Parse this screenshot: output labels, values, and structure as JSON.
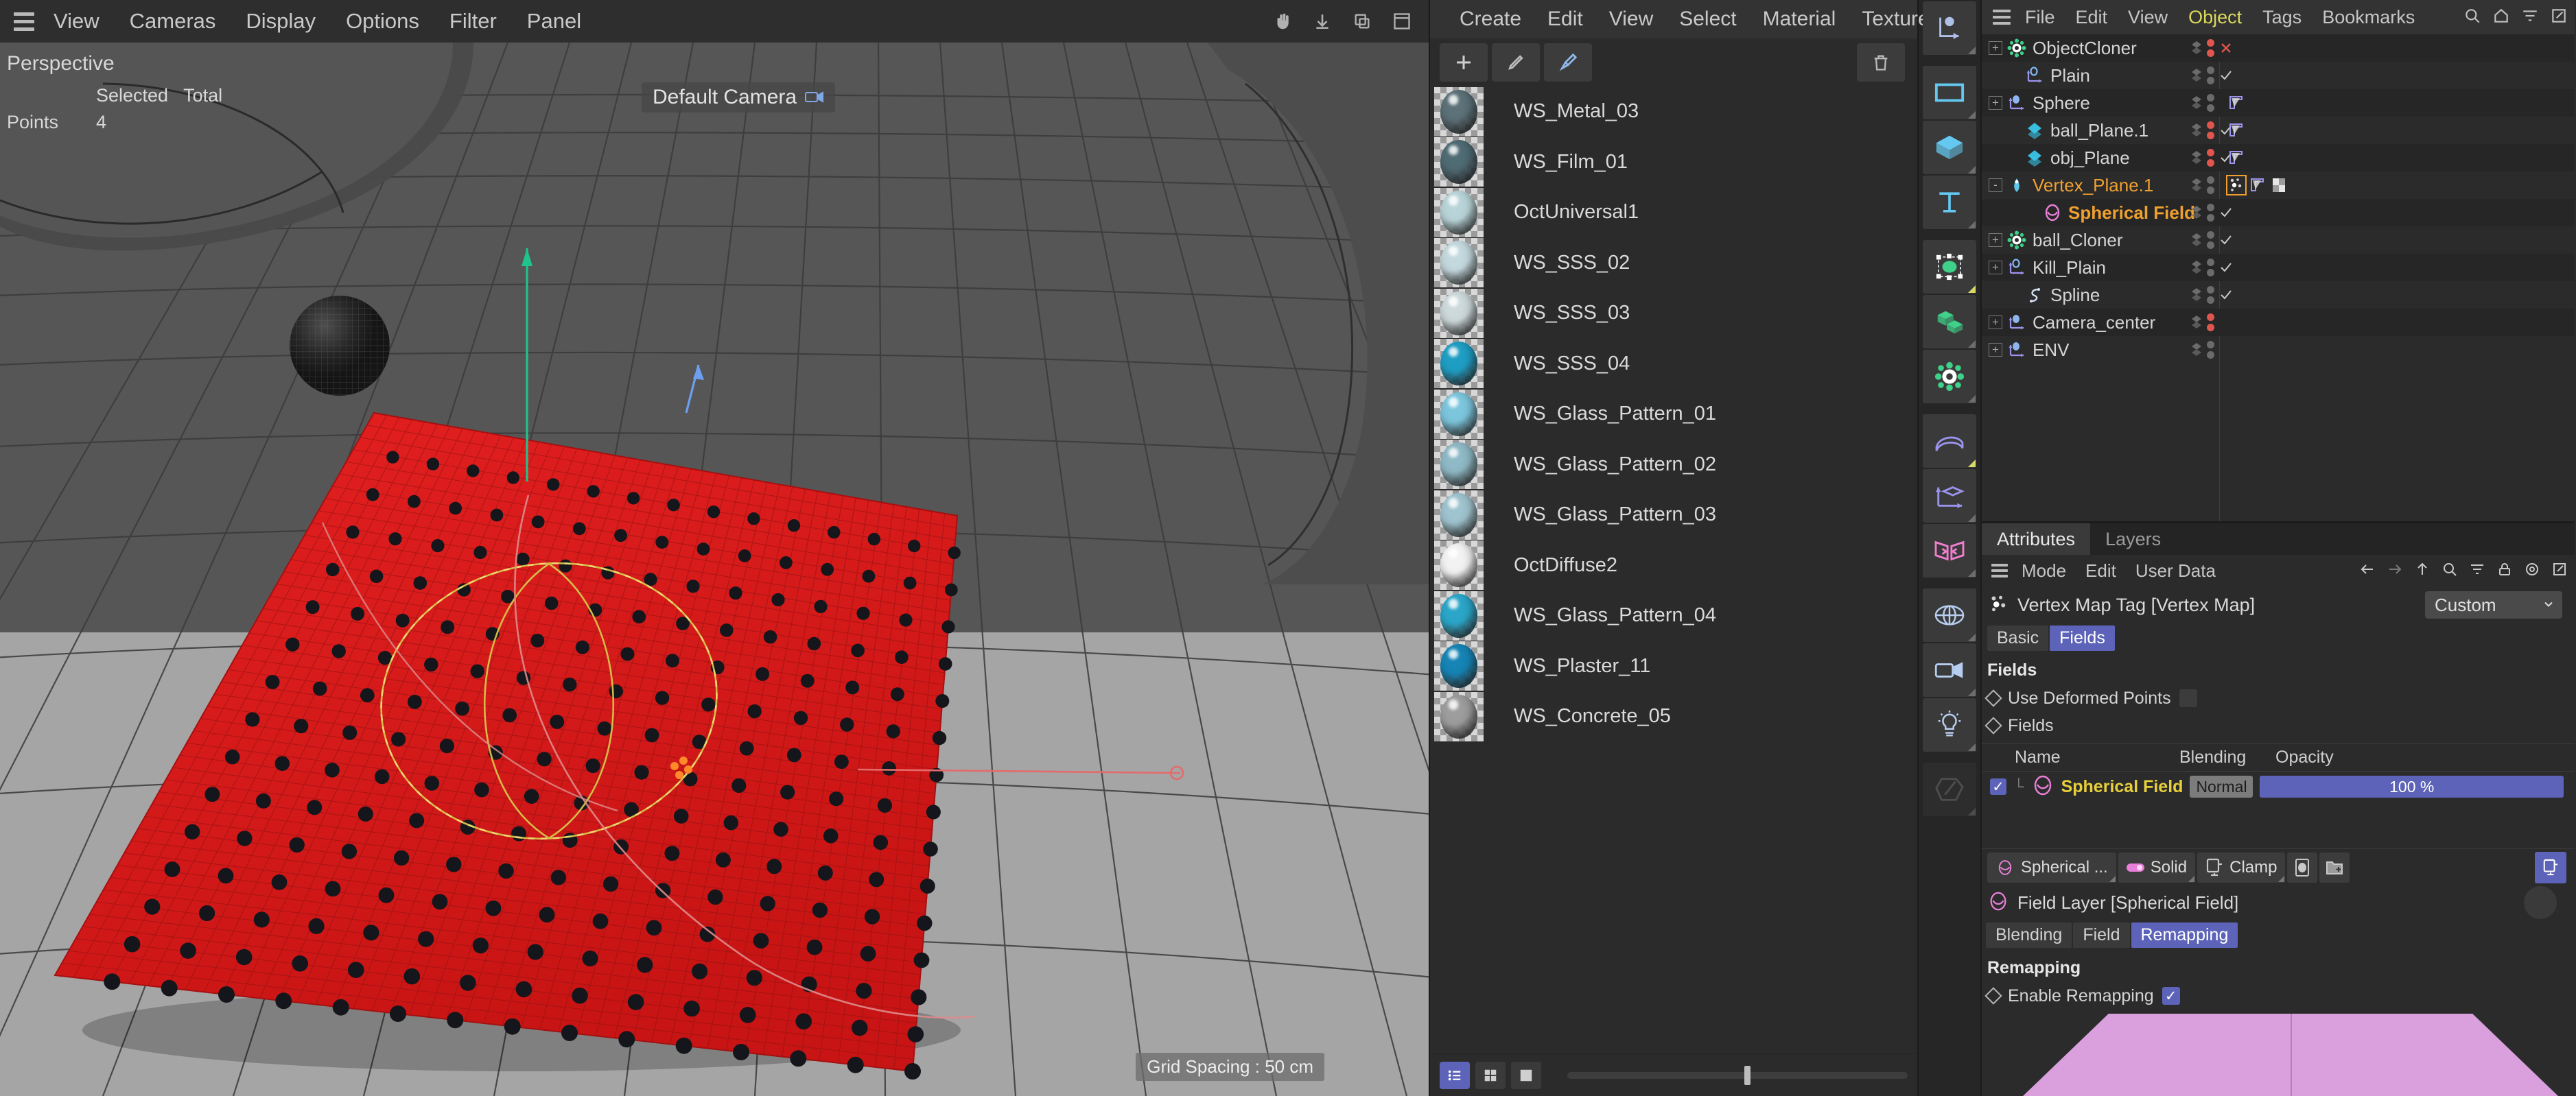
{
  "viewport": {
    "menu": [
      "View",
      "Cameras",
      "Display",
      "Options",
      "Filter",
      "Panel"
    ],
    "perspective_label": "Perspective",
    "stats": {
      "col_selected": "Selected",
      "col_total": "Total",
      "row_label": "Points",
      "points_selected": "4",
      "points_total": ""
    },
    "camera_label": "Default Camera",
    "grid_label": "Grid Spacing : 50 cm",
    "right_icons": [
      "hand-icon",
      "move-down-icon",
      "copy-icon",
      "maximize-icon"
    ]
  },
  "materials": {
    "menu": [
      "Create",
      "Edit",
      "View",
      "Select",
      "Material",
      "Texture"
    ],
    "toolbar": [
      "new-material-button",
      "edit-material-button",
      "pick-material-button"
    ],
    "trash": "delete-material-button",
    "items": [
      {
        "name": "WS_Metal_03",
        "color": "#5c7178",
        "shine": "high"
      },
      {
        "name": "WS_Film_01",
        "color": "#4f6b74",
        "shine": "iridescent"
      },
      {
        "name": "OctUniversal1",
        "color": "#b9d4d8",
        "shine": "soft"
      },
      {
        "name": "WS_SSS_02",
        "color": "#c4d9de",
        "shine": "soft"
      },
      {
        "name": "WS_SSS_03",
        "color": "#cdd9db",
        "shine": "soft"
      },
      {
        "name": "WS_SSS_04",
        "color": "#1f9ec4",
        "shine": "soft"
      },
      {
        "name": "WS_Glass_Pattern_01",
        "color": "#7cc6dd",
        "shine": "soft"
      },
      {
        "name": "WS_Glass_Pattern_02",
        "color": "#8fb9c6",
        "shine": "soft"
      },
      {
        "name": "WS_Glass_Pattern_03",
        "color": "#9fc4cf",
        "shine": "soft"
      },
      {
        "name": "OctDiffuse2",
        "color": "#f2f2f2",
        "shine": "soft"
      },
      {
        "name": "WS_Glass_Pattern_04",
        "color": "#2ba6c9",
        "shine": "soft"
      },
      {
        "name": "WS_Plaster_11",
        "color": "#1684b5",
        "shine": "soft"
      },
      {
        "name": "WS_Concrete_05",
        "color": "#9d9d9d",
        "shine": "soft"
      }
    ],
    "view_buttons": [
      "list-view-button",
      "grid-view-button",
      "large-preview-button"
    ]
  },
  "icon_rail": {
    "items": [
      "axis-move-icon",
      "rectangle-icon",
      "cube-icon",
      "text-icon",
      "selection-field-icon",
      "mograph-icon",
      "simulation-icon",
      "deformer-icon",
      "axis-object-icon",
      "mirror-icon",
      "environment-icon",
      "camera-icon",
      "light-icon",
      "sculpt-icon"
    ]
  },
  "object_manager": {
    "menu": [
      "File",
      "Edit",
      "View",
      "Object",
      "Tags",
      "Bookmarks"
    ],
    "active_menu": "Object",
    "header_icons": [
      "search-icon",
      "home-icon",
      "filter-icon",
      "expand-icon"
    ],
    "tree": [
      {
        "name": "ObjectCloner",
        "indent": 0,
        "icon": "cloner-icon",
        "expander": "+",
        "dots": [
          "red",
          "red"
        ],
        "mark": "x",
        "tags": [],
        "selected": false,
        "bold": false
      },
      {
        "name": "Plain",
        "indent": 1,
        "icon": "effector-icon",
        "expander": "",
        "dots": [
          "gray",
          "gray"
        ],
        "mark": "check",
        "tags": [],
        "selected": false,
        "bold": false
      },
      {
        "name": "Sphere",
        "indent": 0,
        "icon": "sphere-icon",
        "expander": "+",
        "dots": [
          "gray",
          "gray"
        ],
        "mark": "",
        "tags": [
          "phong-tag"
        ],
        "selected": false,
        "bold": false
      },
      {
        "name": "ball_Plane.1",
        "indent": 1,
        "icon": "polygon-icon",
        "expander": "",
        "dots": [
          "red",
          "red"
        ],
        "mark": "check",
        "tags": [
          "phong-tag"
        ],
        "selected": false,
        "bold": false
      },
      {
        "name": "obj_Plane",
        "indent": 1,
        "icon": "polygon-icon",
        "expander": "",
        "dots": [
          "red",
          "red"
        ],
        "mark": "check",
        "tags": [
          "phong-tag"
        ],
        "selected": false,
        "bold": false
      },
      {
        "name": "Vertex_Plane.1",
        "indent": 0,
        "icon": "vertexmap-obj-icon",
        "expander": "-",
        "dots": [
          "gray",
          "gray"
        ],
        "mark": "",
        "tags": [
          "vertex-map-tag",
          "phong-tag",
          "texture-tag"
        ],
        "selected": true,
        "bold": false
      },
      {
        "name": "Spherical Field",
        "indent": 2,
        "icon": "field-icon",
        "expander": "",
        "dots": [
          "gray",
          "gray"
        ],
        "mark": "check",
        "tags": [],
        "selected": true,
        "bold": true
      },
      {
        "name": "ball_Cloner",
        "indent": 0,
        "icon": "cloner-icon",
        "expander": "+",
        "dots": [
          "gray",
          "gray"
        ],
        "mark": "check",
        "tags": [],
        "selected": false,
        "bold": false
      },
      {
        "name": "Kill_Plain",
        "indent": 0,
        "icon": "effector-icon",
        "expander": "+",
        "dots": [
          "gray",
          "gray"
        ],
        "mark": "check",
        "tags": [],
        "selected": false,
        "bold": false
      },
      {
        "name": "Spline",
        "indent": 1,
        "icon": "spline-icon",
        "expander": "",
        "dots": [
          "gray",
          "gray"
        ],
        "mark": "check",
        "tags": [],
        "selected": false,
        "bold": false
      },
      {
        "name": "Camera_center",
        "indent": 0,
        "icon": "sphere-icon",
        "expander": "+",
        "dots": [
          "red",
          "red"
        ],
        "mark": "",
        "tags": [],
        "selected": false,
        "bold": false
      },
      {
        "name": "ENV",
        "indent": 0,
        "icon": "sphere-icon",
        "expander": "+",
        "dots": [
          "gray",
          "gray"
        ],
        "mark": "",
        "tags": [],
        "selected": false,
        "bold": false
      }
    ]
  },
  "attributes": {
    "tabs": [
      {
        "label": "Attributes",
        "active": true
      },
      {
        "label": "Layers",
        "active": false
      }
    ],
    "menu": [
      "Mode",
      "Edit",
      "User Data"
    ],
    "header_icons": [
      "back-arrow-icon",
      "forward-arrow-icon",
      "up-arrow-icon",
      "search-icon",
      "filter-icon",
      "lock-icon",
      "target-icon",
      "popout-icon"
    ],
    "object_title": "Vertex Map Tag [Vertex Map]",
    "preset_dropdown": "Custom",
    "subtabs": [
      {
        "label": "Basic",
        "active": false
      },
      {
        "label": "Fields",
        "active": true
      }
    ],
    "section_title": "Fields",
    "use_deformed_points": {
      "label": "Use Deformed Points",
      "checked": false
    },
    "fields_label": "Fields",
    "table": {
      "headers": [
        "Name",
        "Blending",
        "Opacity"
      ],
      "rows": [
        {
          "checked": true,
          "name": "Spherical Field",
          "blending": "Normal",
          "opacity": "100 %"
        }
      ]
    },
    "layer_toolbar": {
      "field_name": "Spherical ...",
      "solid_label": "Solid",
      "clamp_label": "Clamp",
      "buttons": [
        "field-object-button",
        "field-folder-button"
      ],
      "right_button": "field-layer-toggle"
    },
    "layer_title": "Field Layer [Spherical Field]",
    "layer_subtabs": [
      {
        "label": "Blending",
        "active": false
      },
      {
        "label": "Field",
        "active": false
      },
      {
        "label": "Remapping",
        "active": true
      }
    ],
    "remapping_section": "Remapping",
    "enable_remapping": {
      "label": "Enable Remapping",
      "checked": true
    }
  },
  "colors": {
    "accent_blue": "#5c63b8",
    "selected_orange": "#f0a030",
    "field_yellow": "#e8d03a",
    "field_pink": "#e87fd8",
    "plane_red": "#e01f1f",
    "bg_dark": "#2b2b2b"
  }
}
